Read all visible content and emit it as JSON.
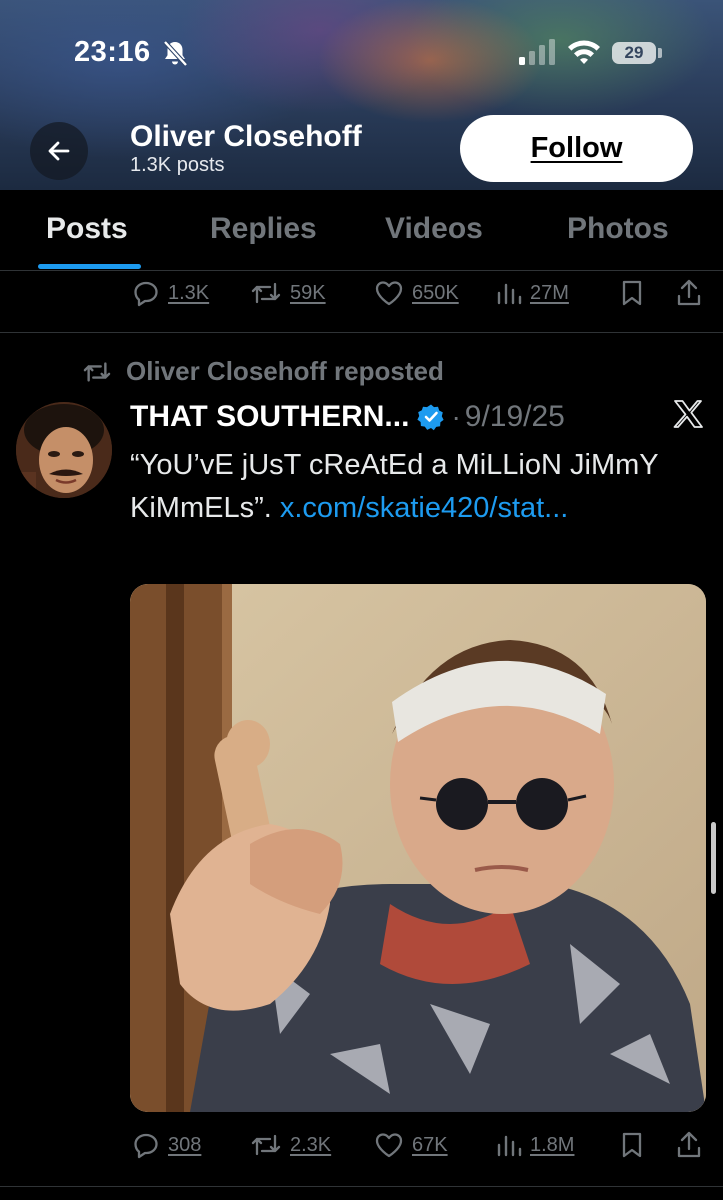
{
  "status_bar": {
    "time": "23:16",
    "battery": "29"
  },
  "header": {
    "profile_name": "Oliver Closehoff",
    "post_count": "1.3K posts",
    "follow_label": "Follow"
  },
  "tabs": [
    {
      "label": "Posts",
      "active": true
    },
    {
      "label": "Replies",
      "active": false
    },
    {
      "label": "Videos",
      "active": false
    },
    {
      "label": "Photos",
      "active": false
    }
  ],
  "previous_post_actions": {
    "replies": "1.3K",
    "reposts": "59K",
    "likes": "650K",
    "views": "27M"
  },
  "tweet": {
    "repost_label": "Oliver Closehoff reposted",
    "author_name": "THAT SOUTHERN...",
    "separator": "·",
    "date": "9/19/25",
    "text": "“YoU’vE jUsT cReAtEd a MiLLioN JiMmY KiMmELs”. ",
    "link_text": "x.com/skatie420/stat...",
    "actions": {
      "replies": "308",
      "reposts": "2.3K",
      "likes": "67K",
      "views": "1.8M"
    }
  },
  "colors": {
    "accent": "#1d9bf0",
    "background": "#000000",
    "muted_text": "#71767b"
  },
  "icons": [
    "bell-slash-icon",
    "signal-icon",
    "wifi-icon",
    "back-arrow-icon",
    "reply-icon",
    "repost-icon",
    "like-icon",
    "views-icon",
    "bookmark-icon",
    "share-icon",
    "verified-icon",
    "x-logo-icon"
  ]
}
